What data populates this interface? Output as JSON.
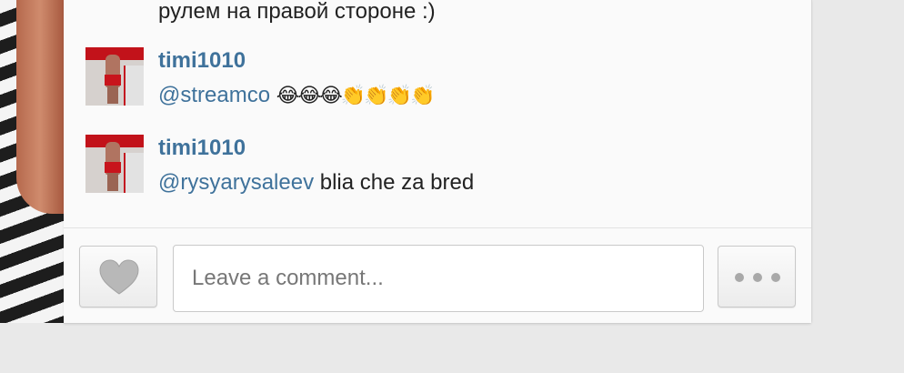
{
  "comments": [
    {
      "text": "рулем на правой стороне :)"
    },
    {
      "username": "timi1010",
      "mention": "@streamco",
      "text": "",
      "emoji": "😂😂😂👏👏👏👏"
    },
    {
      "username": "timi1010",
      "mention": "@rysyarysaleev",
      "text": " blia che za bred"
    }
  ],
  "footer": {
    "comment_placeholder": "Leave a comment...",
    "like_icon": "heart-icon",
    "more_icon": "more-dots-icon"
  },
  "colors": {
    "username": "#3f729b",
    "background": "#fafafa"
  }
}
